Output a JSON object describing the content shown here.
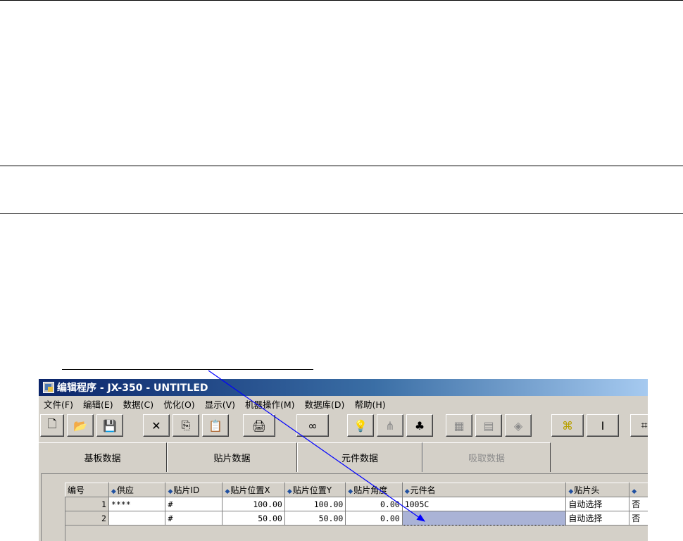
{
  "window": {
    "title": "编辑程序 - JX-350 - UNTITLED",
    "menu": [
      "文件(F)",
      "编辑(E)",
      "数据(C)",
      "优化(O)",
      "显示(V)",
      "机器操作(M)",
      "数据库(D)",
      "帮助(H)"
    ]
  },
  "toolbar": {
    "buttons": [
      {
        "icon": "new-file-icon",
        "glyph": "🗋"
      },
      {
        "icon": "open-folder-icon",
        "glyph": "📂"
      },
      {
        "icon": "save-icon",
        "glyph": "💾"
      },
      {
        "icon": "delete-icon",
        "glyph": "✕"
      },
      {
        "icon": "copy-icon",
        "glyph": "⎘"
      },
      {
        "icon": "paste-icon",
        "glyph": "📋"
      },
      {
        "icon": "print-icon",
        "glyph": "🖨"
      },
      {
        "icon": "binoculars-icon",
        "glyph": "∞"
      },
      {
        "icon": "lightbulb-icon",
        "glyph": "💡"
      },
      {
        "icon": "nozzle-icon",
        "glyph": "⋔"
      },
      {
        "icon": "components-icon",
        "glyph": "♣"
      },
      {
        "icon": "board-icon",
        "glyph": "▦"
      },
      {
        "icon": "feeder-icon",
        "glyph": "▤"
      },
      {
        "icon": "part-icon",
        "glyph": "◈"
      },
      {
        "icon": "mark-icon",
        "glyph": "⌘"
      },
      {
        "icon": "beam-icon",
        "glyph": "Ⅰ"
      },
      {
        "icon": "more-icon",
        "glyph": "⌗"
      }
    ]
  },
  "tabs": [
    {
      "label": "基板数据",
      "state": "normal"
    },
    {
      "label": "贴片数据",
      "state": "active"
    },
    {
      "label": "元件数据",
      "state": "normal"
    },
    {
      "label": "吸取数据",
      "state": "disabled"
    }
  ],
  "grid": {
    "columns": [
      "编号",
      "供应",
      "贴片ID",
      "贴片位置X",
      "贴片位置Y",
      "贴片角度",
      "元件名",
      "贴片头",
      ""
    ],
    "sortable": [
      false,
      true,
      true,
      true,
      true,
      true,
      true,
      true,
      true
    ],
    "rows": [
      [
        "1",
        "****",
        "#",
        "100.00",
        "100.00",
        "0.00",
        "1005C",
        "自动选择",
        "否"
      ],
      [
        "2",
        "",
        "#",
        "50.00",
        "50.00",
        "0.00",
        "",
        "自动选择",
        "否"
      ]
    ],
    "corner_label": "NW"
  }
}
